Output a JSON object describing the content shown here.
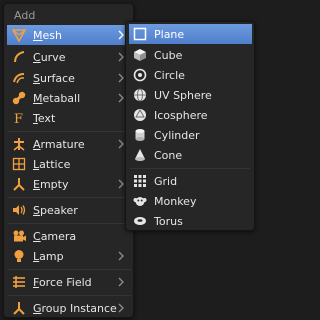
{
  "menu": {
    "title": "Add",
    "items": [
      {
        "label": "Mesh",
        "underline": "M",
        "rest": "esh",
        "icon": "mesh-icon",
        "has_submenu": true,
        "active": true
      },
      {
        "label": "Curve",
        "underline": "C",
        "rest": "urve",
        "icon": "curve-icon",
        "has_submenu": true
      },
      {
        "label": "Surface",
        "underline": "S",
        "rest": "urface",
        "icon": "surface-icon",
        "has_submenu": true
      },
      {
        "label": "Metaball",
        "underline": "M",
        "rest": "etaball",
        "icon": "metaball-icon",
        "has_submenu": true
      },
      {
        "label": "Text",
        "underline": "T",
        "rest": "ext",
        "icon": "text-icon",
        "has_submenu": false
      },
      {
        "label": "Armature",
        "underline": "A",
        "rest": "rmature",
        "icon": "armature-icon",
        "has_submenu": true
      },
      {
        "label": "Lattice",
        "underline": "L",
        "rest": "attice",
        "icon": "lattice-icon",
        "has_submenu": false
      },
      {
        "label": "Empty",
        "underline": "E",
        "rest": "mpty",
        "icon": "empty-icon",
        "has_submenu": true
      },
      {
        "label": "Speaker",
        "underline": "S",
        "rest": "peaker",
        "icon": "speaker-icon",
        "has_submenu": false
      },
      {
        "label": "Camera",
        "underline": "C",
        "rest": "amera",
        "icon": "camera-icon",
        "has_submenu": false
      },
      {
        "label": "Lamp",
        "underline": "L",
        "rest": "amp",
        "icon": "lamp-icon",
        "has_submenu": true
      },
      {
        "label": "Force Field",
        "underline": "F",
        "rest": "orce Field",
        "icon": "force-field-icon",
        "has_submenu": true
      },
      {
        "label": "Group Instance",
        "underline": "G",
        "rest": "roup Instance",
        "icon": "group-instance-icon",
        "has_submenu": true
      }
    ]
  },
  "submenu": {
    "items": [
      {
        "label": "Plane",
        "icon": "plane-icon",
        "active": true
      },
      {
        "label": "Cube",
        "icon": "cube-icon"
      },
      {
        "label": "Circle",
        "icon": "circle-icon"
      },
      {
        "label": "UV Sphere",
        "icon": "uv-sphere-icon"
      },
      {
        "label": "Icosphere",
        "icon": "icosphere-icon"
      },
      {
        "label": "Cylinder",
        "icon": "cylinder-icon"
      },
      {
        "label": "Cone",
        "icon": "cone-icon"
      },
      {
        "label": "Grid",
        "icon": "grid-icon"
      },
      {
        "label": "Monkey",
        "icon": "monkey-icon"
      },
      {
        "label": "Torus",
        "icon": "torus-icon"
      }
    ]
  },
  "colors": {
    "menu_bg": "#262626",
    "highlight": "#5a8ad6",
    "text": "#e6e6e6",
    "title": "#9a9a9a"
  }
}
